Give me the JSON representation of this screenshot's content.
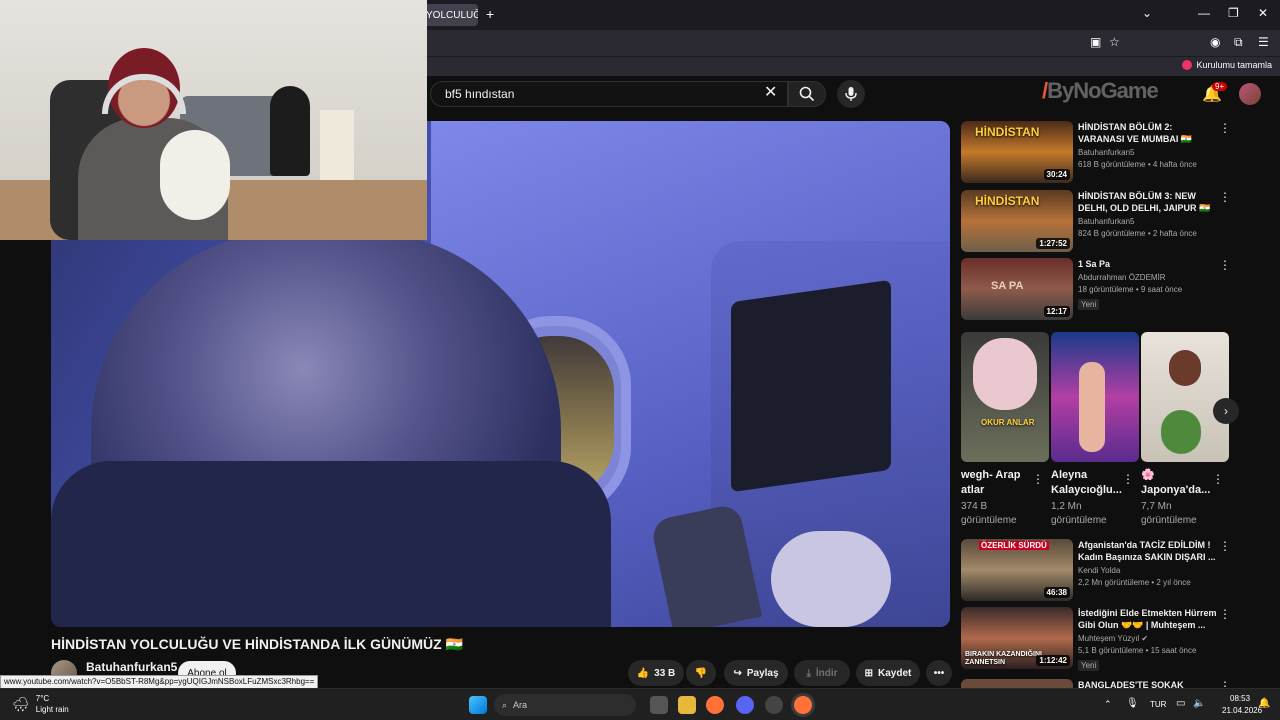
{
  "browser": {
    "tab_title": "YOLCULUĞ",
    "tab_close": "×",
    "new_tab": "+",
    "window_controls": [
      "⌄",
      "—",
      "❐",
      "✕"
    ],
    "bookmark_label": "Kurulumu tamamla"
  },
  "header": {
    "search_value": "bf5 hındıstan",
    "watermark": "ByNoGame",
    "notification_badge": "9+"
  },
  "video": {
    "title": "HİNDİSTAN YOLCULUĞU VE HİNDİSTANDA İLK GÜNÜMÜZ 🇮🇳",
    "channel": "Batuhanfurkan5",
    "subscribe_label": "Abone ol",
    "likes": "33 B",
    "share_label": "Paylaş",
    "download_label": "İndir",
    "save_label": "Kaydet",
    "more_label": "•••"
  },
  "status_url": "www.youtube.com/watch?v=O5BbST-R8Mg&pp=ygUQIGJmNSBoxLFuZMSxc3Rhbg==",
  "recommendations": [
    {
      "title": "HİNDİSTAN BÖLÜM 2: VARANASI VE MUMBAI 🇮🇳",
      "channel": "Batuhanfurkan5",
      "stats": "618 B görüntüleme • 4 hafta önce",
      "duration": "30:24",
      "badge": ""
    },
    {
      "title": "HİNDİSTAN BÖLÜM 3: NEW DELHI, OLD DELHI, JAIPUR 🇮🇳",
      "channel": "Batuhanfurkan5",
      "stats": "824 B görüntüleme • 2 hafta önce",
      "duration": "1:27:52",
      "badge": ""
    },
    {
      "title": "1 Sa Pa",
      "channel": "Abdurrahman ÖZDEMİR",
      "stats": "18 görüntüleme • 9 saat önce",
      "duration": "12:17",
      "badge": "Yeni"
    },
    {
      "title": "Afganistan'da TACİZ EDİLDİM ! Kadın Başınıza SAKIN DIŞARI ...",
      "channel": "Kendi Yolda",
      "stats": "2,2 Mn görüntüleme • 2 yıl önce",
      "duration": "46:38",
      "badge": ""
    },
    {
      "title": "İstediğini Elde Etmekten Hürrem Gibi Olun 🤝🤝 | Muhteşem ...",
      "channel": "Muhteşem Yüzyıl ✔",
      "stats": "5,1 B görüntüleme • 15 saat önce",
      "duration": "1:12:42",
      "badge": "Yeni"
    },
    {
      "title": "BANGLADEŞ'TE SOKAK YEMEĞİ",
      "channel": "",
      "stats": "",
      "duration": "",
      "badge": ""
    }
  ],
  "shorts": [
    {
      "title": "wegh- Arap atlar",
      "views": "374 B görüntüleme",
      "overlay": "OKUR ANLAR"
    },
    {
      "title": "Aleyna Kalaycıoğlu...",
      "views": "1,2 Mn görüntüleme",
      "overlay": ""
    },
    {
      "title": "🌸 Japonya'da...",
      "views": "7,7 Mn görüntüleme",
      "overlay": ""
    }
  ],
  "thumb_texts": {
    "t1": "HİNDİSTAN",
    "t2": "HİNDİSTAN",
    "t3": "SA PA",
    "t4": "ÖZERLİK SÜRDÜ",
    "t5": "BIRAKIN KAZANDIĞINI ZANNETSIN"
  },
  "taskbar": {
    "temp": "7°C",
    "weather": "Light rain",
    "search_placeholder": "Ara",
    "language": "TUR",
    "time": "08:53",
    "date": "21.04.2026"
  },
  "colors": {
    "background": "#0f0f0f",
    "accent_red": "#cc0000",
    "chip_bg": "#272727"
  }
}
